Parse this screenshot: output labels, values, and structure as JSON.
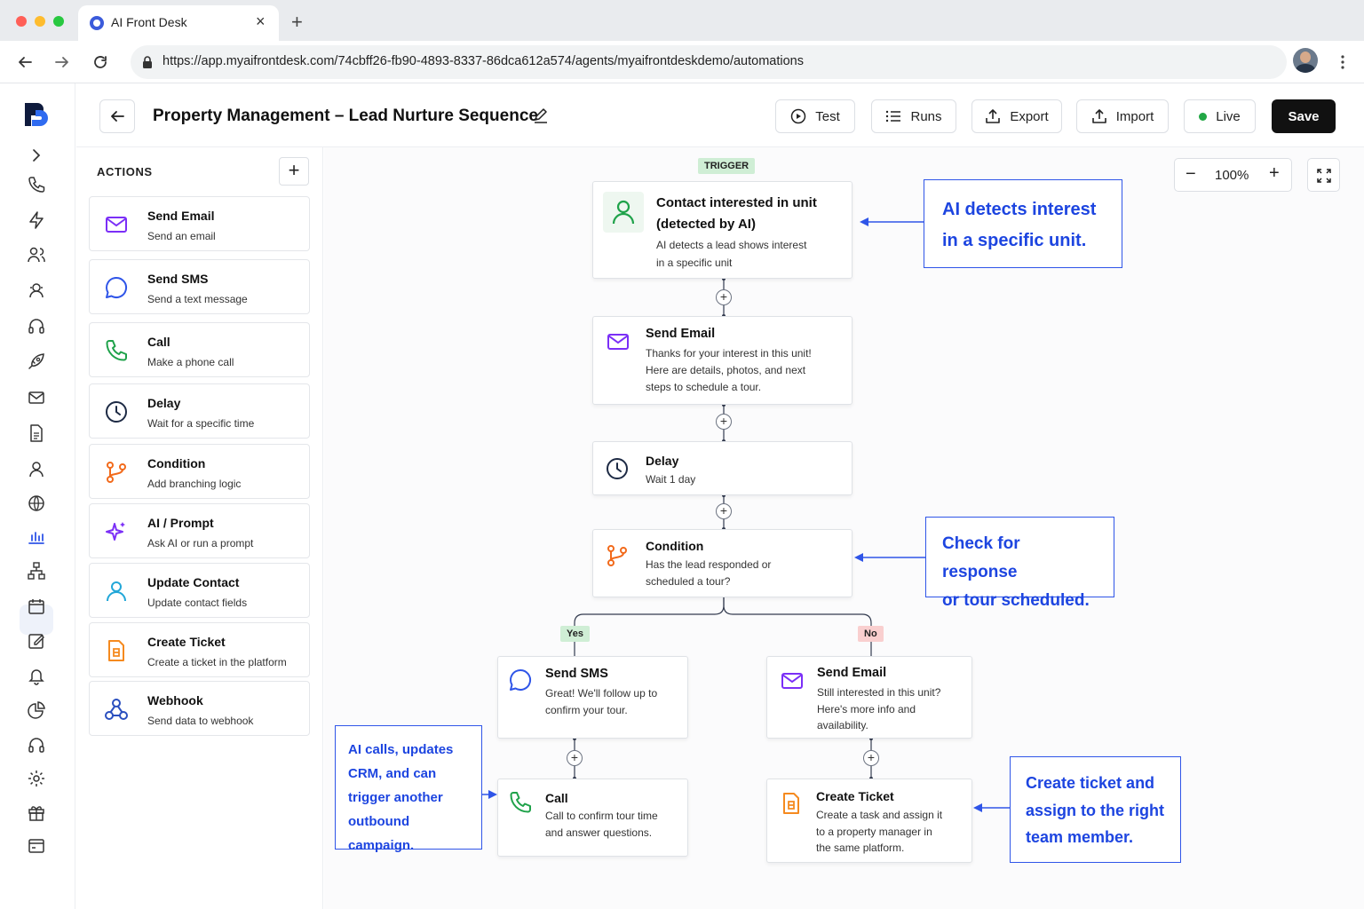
{
  "browser": {
    "tab_title": "AI Front Desk",
    "url": "https://app.myaifrontdesk.com/74cbff26-fb90-4893-8337-86dca612a574/agents/myaifrontdeskdemo/automations",
    "new_tab": "+",
    "close_tab": "×"
  },
  "header": {
    "title": "Property Management – Lead Nurture Sequence",
    "buttons": {
      "test": "Test",
      "runs": "Runs",
      "export": "Export",
      "import": "Import",
      "live": "Live",
      "save": "Save"
    }
  },
  "actions": {
    "title": "ACTIONS",
    "items": [
      {
        "title": "Send Email",
        "subtitle": "Send an email",
        "icon": "mail-icon"
      },
      {
        "title": "Send SMS",
        "subtitle": "Send a text message",
        "icon": "chat-icon"
      },
      {
        "title": "Call",
        "subtitle": "Make a phone call",
        "icon": "phone-icon"
      },
      {
        "title": "Delay",
        "subtitle": "Wait for a specific time",
        "icon": "clock-icon"
      },
      {
        "title": "Condition",
        "subtitle": "Add branching logic",
        "icon": "branch-icon"
      },
      {
        "title": "AI / Prompt",
        "subtitle": "Ask AI or run a prompt",
        "icon": "sparkle-icon"
      },
      {
        "title": "Update Contact",
        "subtitle": "Update contact fields",
        "icon": "user-icon"
      },
      {
        "title": "Create Ticket",
        "subtitle": "Create a ticket in the platform",
        "icon": "ticket-icon"
      },
      {
        "title": "Webhook",
        "subtitle": "Send data to webhook",
        "icon": "webhook-icon"
      }
    ]
  },
  "canvas": {
    "zoom": "100%",
    "trigger_tag": "TRIGGER",
    "yes_tag": "Yes",
    "no_tag": "No",
    "nodes": {
      "trigger": {
        "title": "Contact interested in unit\n(detected by AI)",
        "desc": "AI detects a lead shows interest\nin a specific unit"
      },
      "email1": {
        "title": "Send Email",
        "desc": "Thanks for your interest in this unit!\nHere are details, photos, and next\nsteps to schedule a tour."
      },
      "delay": {
        "title": "Delay",
        "desc": "Wait 1 day"
      },
      "condition": {
        "title": "Condition",
        "desc": "Has the lead responded or\nscheduled a tour?"
      },
      "sms": {
        "title": "Send SMS",
        "desc": "Great! We'll follow up to\nconfirm your tour."
      },
      "email2": {
        "title": "Send Email",
        "desc": "Still interested in this unit?\nHere's more info and\navailability."
      },
      "call": {
        "title": "Call",
        "desc": "Call to confirm tour time\nand answer questions."
      },
      "ticket": {
        "title": "Create Ticket",
        "desc": "Create a task and assign it\nto a property manager in\nthe same platform."
      }
    },
    "callouts": {
      "detect": "AI detects interest\nin a specific unit.",
      "check": "Check for response\nor tour scheduled.",
      "calls": "AI calls, updates\nCRM, and can\ntrigger another\noutbound campaign.",
      "ticket": "Create ticket and\nassign to the right\nteam member."
    }
  },
  "colors": {
    "callout_blue": "#2f55e8",
    "live_green": "#22a745",
    "save_bg": "#111111",
    "trigger_tag_bg": "#cfeed5",
    "yes_tag_bg": "#cfeed5",
    "no_tag_bg": "#f9cfcf"
  }
}
